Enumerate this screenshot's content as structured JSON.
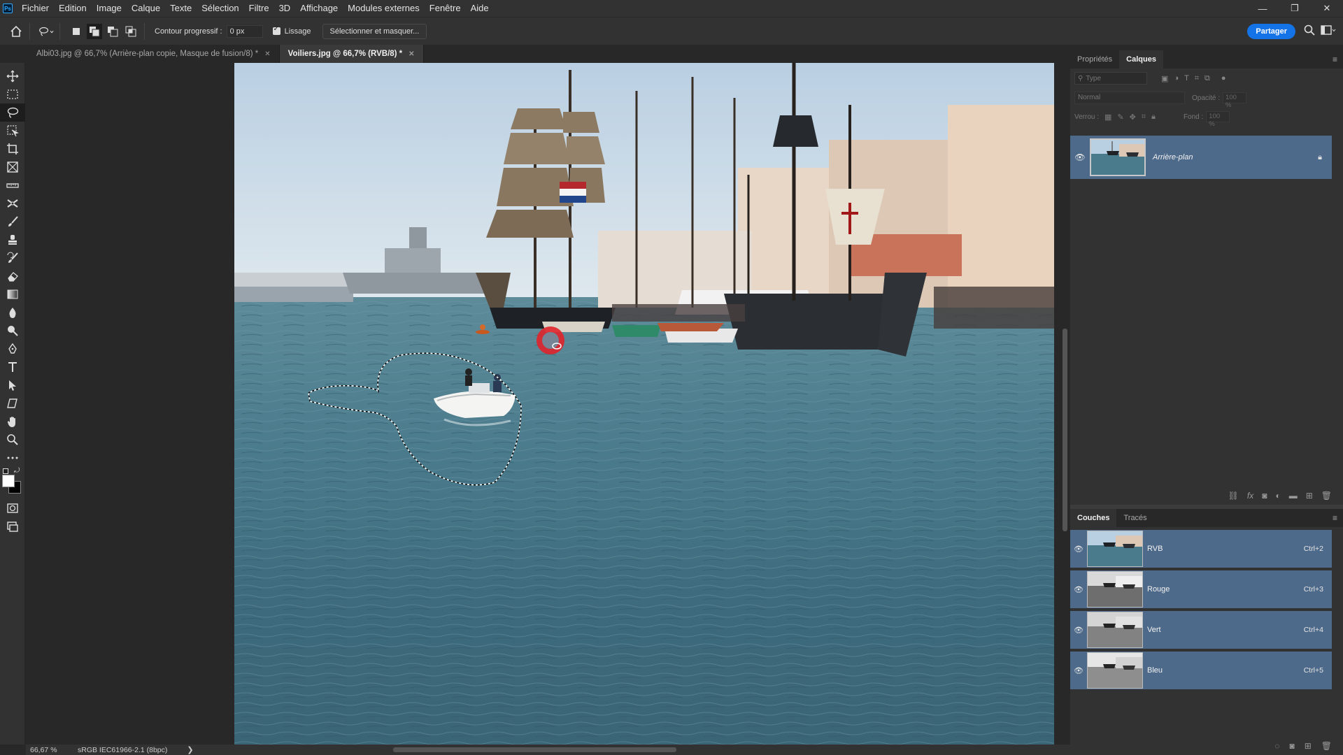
{
  "menu": {
    "items": [
      "Fichier",
      "Edition",
      "Image",
      "Calque",
      "Texte",
      "Sélection",
      "Filtre",
      "3D",
      "Affichage",
      "Modules externes",
      "Fenêtre",
      "Aide"
    ]
  },
  "options": {
    "feather_label": "Contour progressif :",
    "feather_value": "0 px",
    "antialias_label": "Lissage",
    "select_mask_label": "Sélectionner et masquer...",
    "share_label": "Partager"
  },
  "tabs": [
    {
      "label": "Albi03.jpg @ 66,7% (Arrière-plan copie, Masque de fusion/8) *",
      "active": false
    },
    {
      "label": "Voiliers.jpg @ 66,7% (RVB/8) *",
      "active": true
    }
  ],
  "status": {
    "zoom": "66,67 %",
    "profile": "sRGB IEC61966-2.1 (8bpc)",
    "arrow": "❯"
  },
  "layers_panel": {
    "tabs": [
      "Propriétés",
      "Calques"
    ],
    "filter_placeholder": "Type",
    "blend_mode": "Normal",
    "opacity_label": "Opacité :",
    "opacity_value": "100 %",
    "lock_label": "Verrou :",
    "fill_label": "Fond :",
    "fill_value": "100 %",
    "layers": [
      {
        "name": "Arrière-plan",
        "visible": true,
        "locked": true
      }
    ]
  },
  "channels_panel": {
    "tabs": [
      "Couches",
      "Tracés"
    ],
    "channels": [
      {
        "name": "RVB",
        "shortcut": "Ctrl+2"
      },
      {
        "name": "Rouge",
        "shortcut": "Ctrl+3"
      },
      {
        "name": "Vert",
        "shortcut": "Ctrl+4"
      },
      {
        "name": "Bleu",
        "shortcut": "Ctrl+5"
      }
    ]
  },
  "colors": {
    "accent": "#1473e6",
    "selected_row": "#4e6a8a",
    "cursor_highlight": "#e0242b"
  }
}
